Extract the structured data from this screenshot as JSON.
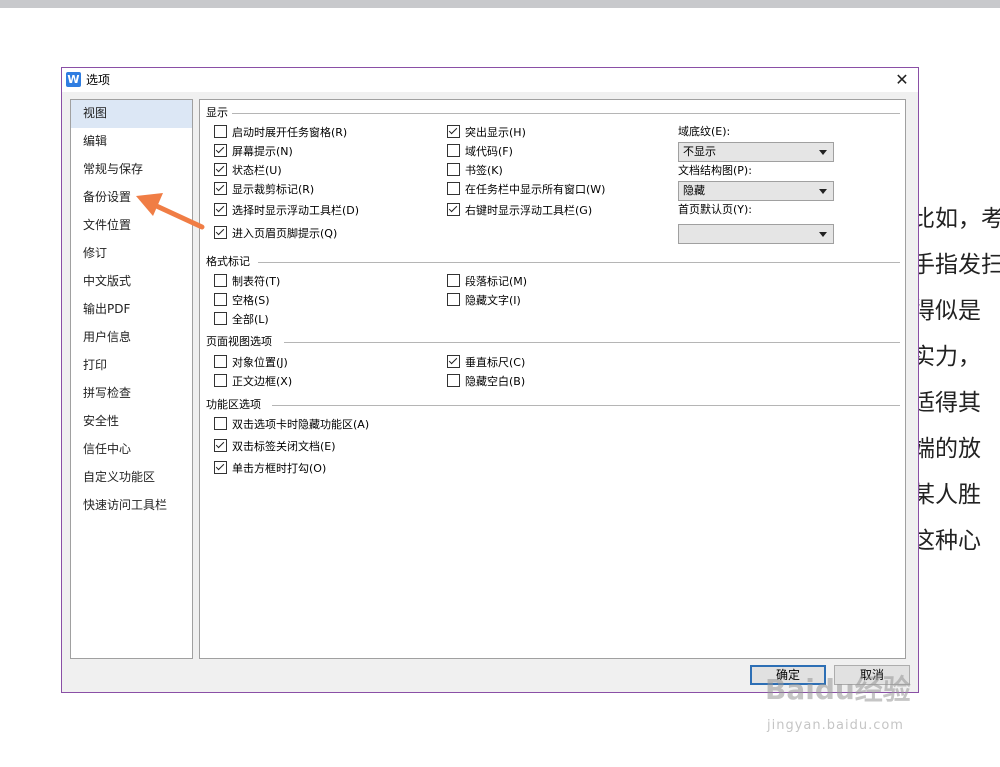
{
  "background_text": [
    "比如，考",
    "手指发扫",
    "得似是",
    "实力，",
    "适得其",
    "端的放",
    "某人胜",
    "这种心"
  ],
  "dialog": {
    "title": "选项",
    "close": "✕",
    "app_icon": "W"
  },
  "sidebar": {
    "items": [
      "视图",
      "编辑",
      "常规与保存",
      "备份设置",
      "文件位置",
      "修订",
      "中文版式",
      "输出PDF",
      "用户信息",
      "打印",
      "拼写检查",
      "安全性",
      "信任中心",
      "自定义功能区",
      "快速访问工具栏"
    ],
    "selected": "视图"
  },
  "display": {
    "heading": "显示",
    "col1": [
      {
        "label": "启动时展开任务窗格(R)",
        "checked": false
      },
      {
        "label": "屏幕提示(N)",
        "checked": true
      },
      {
        "label": "状态栏(U)",
        "checked": true
      },
      {
        "label": "显示裁剪标记(R)",
        "checked": true
      },
      {
        "label": "选择时显示浮动工具栏(D)",
        "checked": true
      },
      {
        "label": "进入页眉页脚提示(Q)",
        "checked": true
      }
    ],
    "col2": [
      {
        "label": "突出显示(H)",
        "checked": true
      },
      {
        "label": "域代码(F)",
        "checked": false
      },
      {
        "label": "书签(K)",
        "checked": false
      },
      {
        "label": "在任务栏中显示所有窗口(W)",
        "checked": false
      },
      {
        "label": "右键时显示浮动工具栏(G)",
        "checked": true
      }
    ],
    "field_shading_label": "域底纹(E):",
    "field_shading_value": "不显示",
    "doc_map_label": "文档结构图(P):",
    "doc_map_value": "隐藏",
    "home_page_label": "首页默认页(Y):",
    "home_page_value": ""
  },
  "format_marks": {
    "heading": "格式标记",
    "col1": [
      {
        "label": "制表符(T)",
        "checked": false
      },
      {
        "label": "空格(S)",
        "checked": false
      },
      {
        "label": "全部(L)",
        "checked": false
      }
    ],
    "col2": [
      {
        "label": "段落标记(M)",
        "checked": false
      },
      {
        "label": "隐藏文字(I)",
        "checked": false
      }
    ]
  },
  "page_view": {
    "heading": "页面视图选项",
    "col1": [
      {
        "label": "对象位置(J)",
        "checked": false
      },
      {
        "label": "正文边框(X)",
        "checked": false
      }
    ],
    "col2": [
      {
        "label": "垂直标尺(C)",
        "checked": true
      },
      {
        "label": "隐藏空白(B)",
        "checked": false
      }
    ]
  },
  "ribbon": {
    "heading": "功能区选项",
    "items": [
      {
        "label": "双击选项卡时隐藏功能区(A)",
        "checked": false
      },
      {
        "label": "双击标签关闭文档(E)",
        "checked": true
      },
      {
        "label": "单击方框时打勾(O)",
        "checked": true
      }
    ]
  },
  "buttons": {
    "ok": "确定",
    "cancel": "取消"
  },
  "watermark": {
    "logo": "Baidu经验",
    "url": "jingyan.baidu.com"
  },
  "colors": {
    "accent": "#2d6fb5",
    "arrow": "#f07d45",
    "dialog_border": "#8a4fa6"
  }
}
